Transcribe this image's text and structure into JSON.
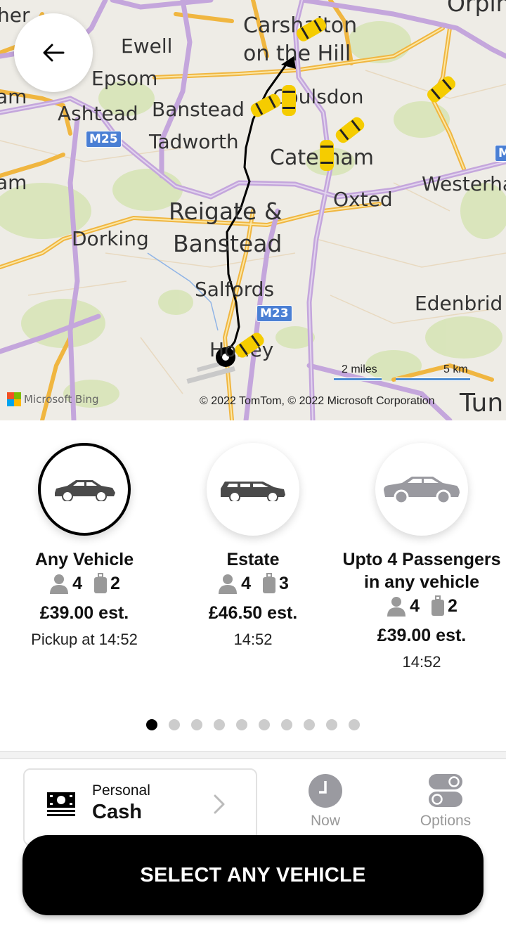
{
  "map": {
    "places": [
      {
        "id": "carshalton",
        "text": "Carshalton"
      },
      {
        "id": "on-the-hill",
        "text": "on the Hill"
      },
      {
        "id": "ewell",
        "text": "Ewell"
      },
      {
        "id": "epsom",
        "text": "Epsom"
      },
      {
        "id": "ashtead",
        "text": "Ashtead"
      },
      {
        "id": "banstead",
        "text": "Banstead"
      },
      {
        "id": "coulsdon",
        "text": "Coulsdon"
      },
      {
        "id": "tadworth",
        "text": "Tadworth"
      },
      {
        "id": "caterham",
        "text": "Caterham"
      },
      {
        "id": "reigate",
        "text": "Reigate &"
      },
      {
        "id": "banstead2",
        "text": "Banstead"
      },
      {
        "id": "oxted",
        "text": "Oxted"
      },
      {
        "id": "westerham",
        "text": "Westerha"
      },
      {
        "id": "dorking",
        "text": "Dorking"
      },
      {
        "id": "salfords",
        "text": "Salfords"
      },
      {
        "id": "horley",
        "text": "Horley"
      },
      {
        "id": "edenbridge",
        "text": "Edenbrid"
      },
      {
        "id": "orpington",
        "text": "Orpin"
      },
      {
        "id": "tunbridge",
        "text": "Tun"
      },
      {
        "id": "left-her",
        "text": "her"
      },
      {
        "id": "left-am1",
        "text": "am"
      },
      {
        "id": "left-am2",
        "text": "am"
      }
    ],
    "road_shields": [
      "M25",
      "M23",
      "M"
    ],
    "scale_miles": "2 miles",
    "scale_km": "5 km",
    "copyright": "© 2022 TomTom, © 2022 Microsoft Corporation",
    "provider": "Microsoft Bing",
    "back_icon": "arrow-left-icon",
    "taxi_icon": "taxi-marker-icon"
  },
  "vehicles": [
    {
      "name": "Any Vehicle",
      "passengers": "4",
      "luggage": "2",
      "price": "£39.00 est.",
      "pickup": "Pickup at 14:52",
      "selected": true
    },
    {
      "name": "Estate",
      "passengers": "4",
      "luggage": "3",
      "price": "£46.50 est.",
      "pickup": "14:52",
      "selected": false
    },
    {
      "name": "Upto 4 Passengers in any vehicle",
      "passengers": "4",
      "luggage": "2",
      "price": "£39.00 est.",
      "pickup": "14:52",
      "selected": false
    }
  ],
  "pagination": {
    "total": 10,
    "active": 1
  },
  "payment": {
    "type": "Personal",
    "method": "Cash",
    "icon": "cash-icon"
  },
  "toolbar": {
    "now_label": "Now",
    "options_label": "Options"
  },
  "cta": {
    "label": "SELECT ANY VEHICLE"
  },
  "colors": {
    "accent": "#000000",
    "taxi": "#f5cc00",
    "shield": "#4a7fd4",
    "muted": "#999999"
  }
}
